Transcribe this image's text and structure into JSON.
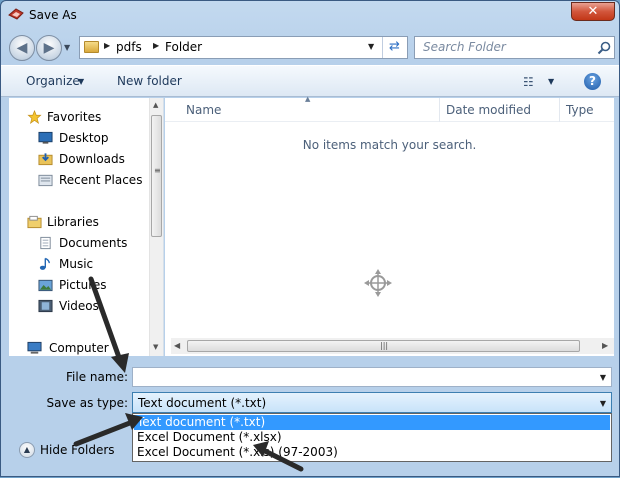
{
  "window": {
    "title": "Save As",
    "close_glyph": "✕"
  },
  "address_bar": {
    "crumbs": [
      "pdfs",
      "Folder"
    ],
    "refresh_glyph": "⇄"
  },
  "search": {
    "placeholder": "Search Folder"
  },
  "toolbar": {
    "organize_label": "Organize",
    "new_folder_label": "New folder",
    "help_glyph": "?"
  },
  "nav_pane": {
    "items": [
      {
        "label": "Favorites",
        "icon": "star-icon"
      },
      {
        "label": "Desktop",
        "icon": "desktop-icon"
      },
      {
        "label": "Downloads",
        "icon": "downloads-icon"
      },
      {
        "label": "Recent Places",
        "icon": "recent-places-icon"
      },
      {
        "label": "Libraries",
        "icon": "libraries-icon"
      },
      {
        "label": "Documents",
        "icon": "documents-icon"
      },
      {
        "label": "Music",
        "icon": "music-icon"
      },
      {
        "label": "Pictures",
        "icon": "pictures-icon"
      },
      {
        "label": "Videos",
        "icon": "videos-icon"
      },
      {
        "label": "Computer",
        "icon": "computer-icon"
      }
    ]
  },
  "file_pane": {
    "columns": [
      "Name",
      "Date modified",
      "Type"
    ],
    "empty_message": "No items match your search."
  },
  "form": {
    "file_name_label": "File name:",
    "file_name_value": "",
    "save_as_type_label": "Save as type:",
    "save_as_type_value": "Text document (*.txt)",
    "type_options": [
      "Text document (*.txt)",
      "Excel Document (*.xlsx)",
      "Excel Document (*.xls) (97-2003)"
    ],
    "selected_option_index": 0
  },
  "hide_folders_label": "Hide Folders",
  "colors": {
    "accent": "#3399ff",
    "title_bar": "#c3d9ef",
    "close_button": "#c23718"
  }
}
